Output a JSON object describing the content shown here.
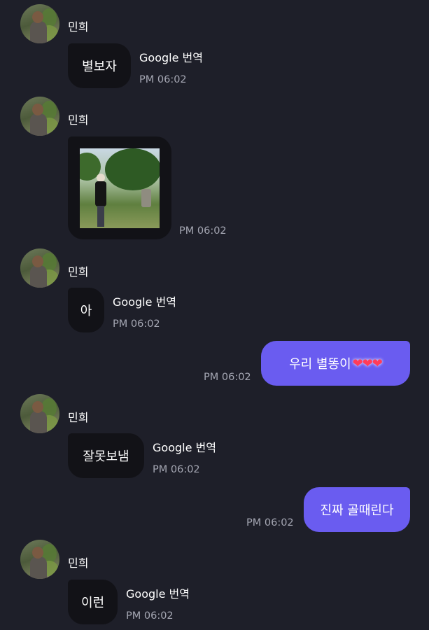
{
  "sender_name": "민희",
  "translate_label": "Google 번역",
  "messages": [
    {
      "type": "in",
      "text": "별보자",
      "time": "PM 06:02"
    },
    {
      "type": "in-photo",
      "time": "PM 06:02"
    },
    {
      "type": "in",
      "text": "아",
      "time": "PM 06:02"
    },
    {
      "type": "out",
      "text": "우리 별똥이",
      "hearts": "❤❤❤",
      "time": "PM 06:02"
    },
    {
      "type": "in",
      "text": "잘못보냄",
      "time": "PM 06:02"
    },
    {
      "type": "out",
      "text": "진짜 골때린다",
      "time": "PM 06:02"
    },
    {
      "type": "in",
      "text": "이런",
      "time": "PM 06:02"
    }
  ],
  "colors": {
    "background": "#1e1f29",
    "incoming_bubble": "#121217",
    "outgoing_bubble": "#6a5cf0",
    "time_text": "#a5a7b3"
  }
}
